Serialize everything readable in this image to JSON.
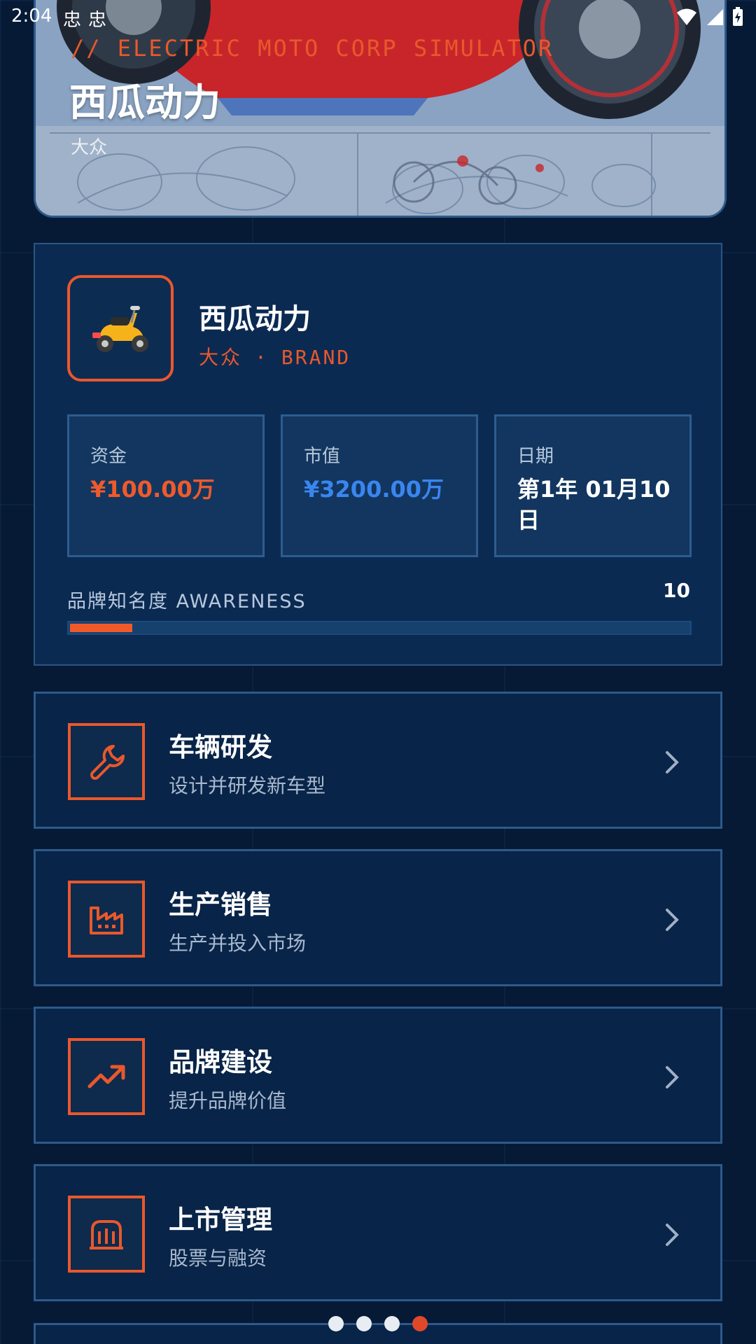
{
  "status_bar": {
    "time": "2:04",
    "notification_glyph": "忠"
  },
  "hero": {
    "tagline": "// ELECTRIC MOTO CORP SIMULATOR",
    "title": "西瓜动力",
    "subtitle": "大众"
  },
  "company": {
    "logo_icon": "scooter-icon",
    "name": "西瓜动力",
    "segment": "大众",
    "separator": "·",
    "type_label": "BRAND",
    "stats": [
      {
        "label": "资金",
        "value": "¥100.00万"
      },
      {
        "label": "市值",
        "value": "¥3200.00万"
      },
      {
        "label": "日期",
        "value": "第1年  01月10日"
      }
    ],
    "awareness": {
      "label": "品牌知名度  AWARENESS",
      "value": "10",
      "progress": 0.1
    }
  },
  "menu": [
    {
      "icon": "wrench-icon",
      "title": "车辆研发",
      "desc": "设计并研发新车型"
    },
    {
      "icon": "factory-icon",
      "title": "生产销售",
      "desc": "生产并投入市场"
    },
    {
      "icon": "trending-up-icon",
      "title": "品牌建设",
      "desc": "提升品牌价值"
    },
    {
      "icon": "stock-exchange-icon",
      "title": "上市管理",
      "desc": "股票与融资"
    }
  ],
  "pager": {
    "count": 4,
    "active_index": 3
  },
  "colors": {
    "background": "#061a36",
    "accent": "#e9582c",
    "market_value": "#3a86f0",
    "card": "#0b2a52"
  }
}
